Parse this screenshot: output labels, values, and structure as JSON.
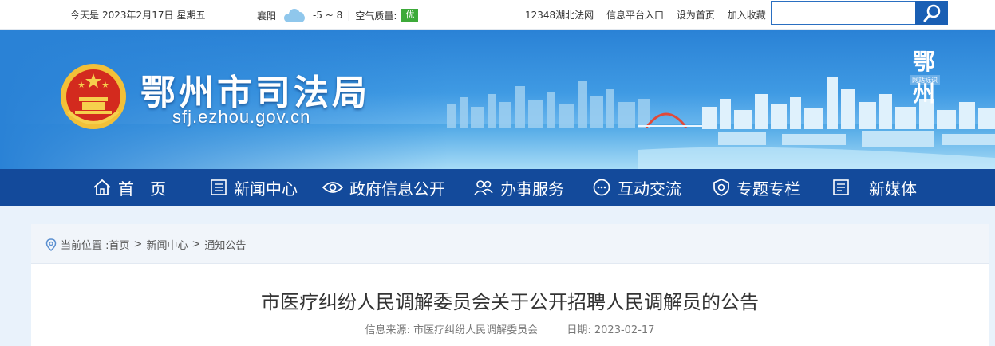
{
  "topbar": {
    "date_prefix": "今天是",
    "date": "2023年2月17日",
    "weekday": "星期五",
    "weather_city": "襄阳",
    "weather_icon": "cloud-icon",
    "temperature": "-5 ~ 8",
    "air_quality_label": "空气质量:",
    "air_quality_value": "优",
    "links": [
      "12348湖北法网",
      "信息平台入口",
      "设为首页",
      "加入收藏"
    ],
    "search_placeholder": "",
    "search_icon": "search-icon"
  },
  "banner": {
    "site_title": "鄂州市司法局",
    "site_domain": "sfj.ezhou.gov.cn",
    "badge_name": "鄂州",
    "badge_tag": "网站标识"
  },
  "nav": [
    {
      "label": "首　页",
      "icon": "home-icon"
    },
    {
      "label": "新闻中心",
      "icon": "news-icon"
    },
    {
      "label": "政府信息公开",
      "icon": "eye-icon"
    },
    {
      "label": "办事服务",
      "icon": "people-icon"
    },
    {
      "label": "互动交流",
      "icon": "chat-icon"
    },
    {
      "label": "专题专栏",
      "icon": "shield-icon"
    },
    {
      "label": "新媒体",
      "icon": "media-icon"
    }
  ],
  "breadcrumb": {
    "prefix": "当前位置 :",
    "items": [
      "首页",
      "新闻中心",
      "通知公告"
    ],
    "separator": ">"
  },
  "article": {
    "title": "市医疗纠纷人民调解委员会关于公开招聘人民调解员的公告",
    "source_label": "信息来源:",
    "source": "市医疗纠纷人民调解委员会",
    "date_label": "日期:",
    "date": "2023-02-17"
  },
  "colors": {
    "nav_bg": "#134a9b",
    "search_btn": "#1a5fb4",
    "aq_badge": "#3daa3a",
    "page_bg": "#e9f2fb"
  }
}
